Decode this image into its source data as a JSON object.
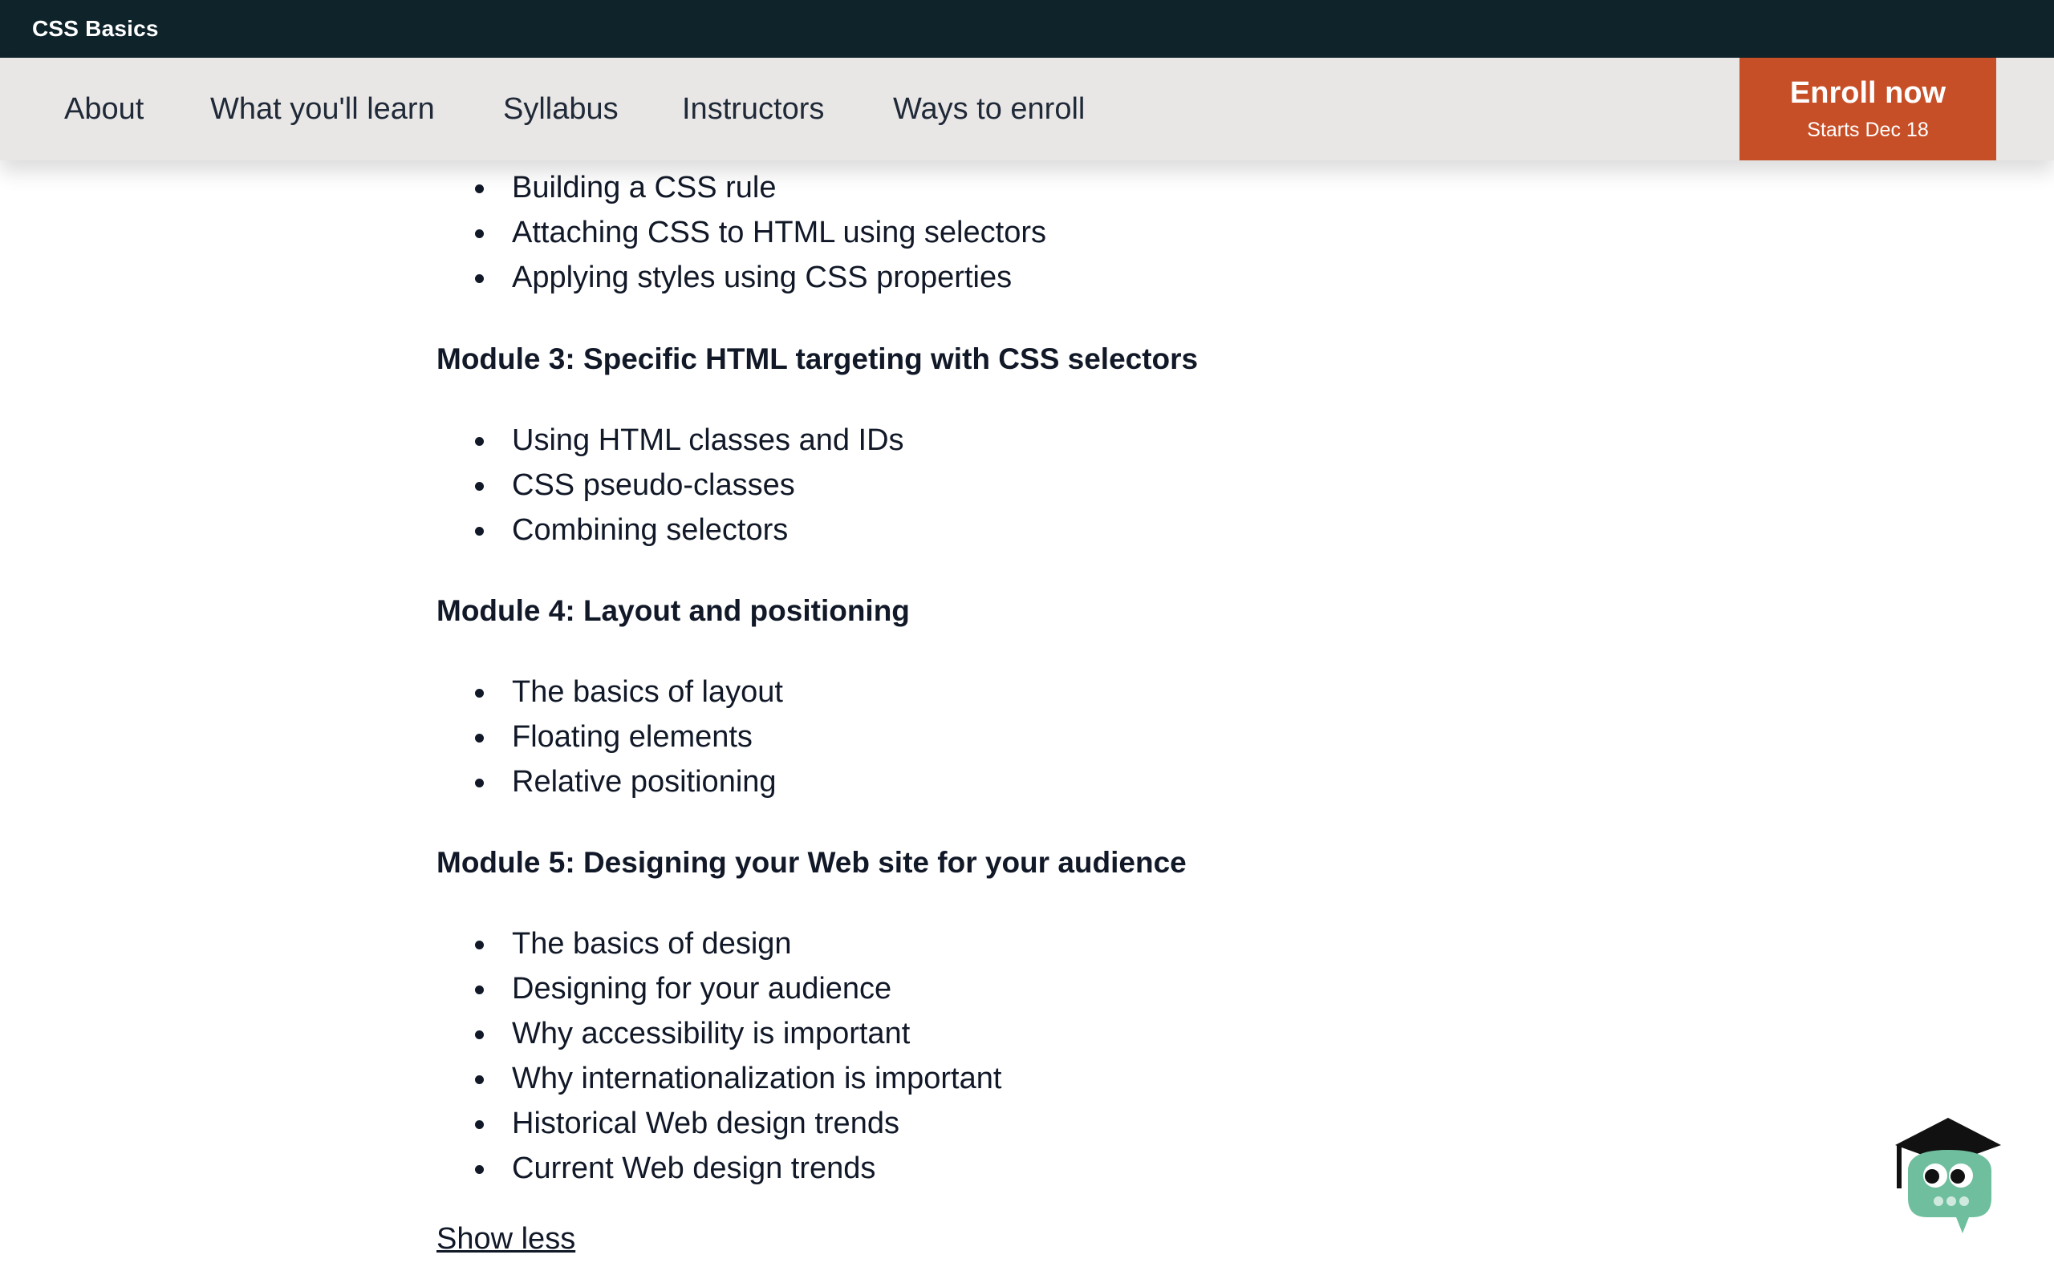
{
  "topbar": {
    "brand": "CSS Basics"
  },
  "nav": {
    "links": [
      "About",
      "What you'll learn",
      "Syllabus",
      "Instructors",
      "Ways to enroll"
    ],
    "enroll": {
      "label": "Enroll now",
      "sub": "Starts Dec 18"
    }
  },
  "syllabus": {
    "partial_items": [
      "Building a CSS rule",
      "Attaching CSS to HTML using selectors",
      "Applying styles using CSS properties"
    ],
    "modules": [
      {
        "title": "Module 3: Specific HTML targeting with CSS selectors",
        "items": [
          "Using HTML classes and IDs",
          "CSS pseudo-classes",
          "Combining selectors"
        ]
      },
      {
        "title": "Module 4: Layout and positioning",
        "items": [
          "The basics of layout",
          "Floating elements",
          "Relative positioning"
        ]
      },
      {
        "title": "Module 5: Designing your Web site for your audience",
        "items": [
          "The basics of design",
          "Designing for your audience",
          "Why accessibility is important",
          "Why internationalization is important",
          "Historical Web design trends",
          "Current Web design trends"
        ]
      }
    ],
    "toggle_label": "Show less"
  },
  "colors": {
    "topbar_bg": "#0f232b",
    "nav_bg": "#e9e7e6",
    "enroll_bg": "#c74f27",
    "mascot_body": "#6fbf9f"
  },
  "icons": {
    "mascot": "owl-graduate-icon"
  }
}
